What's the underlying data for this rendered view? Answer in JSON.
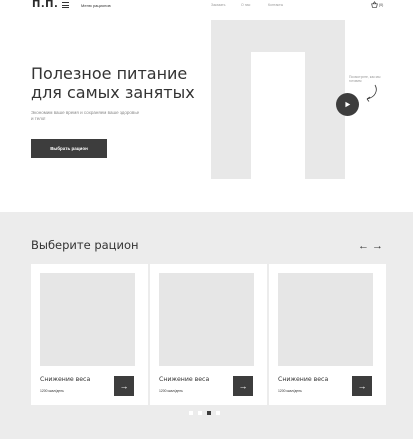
{
  "header": {
    "logo": "П.П.",
    "menu_label": "Меню рационов",
    "nav": [
      "Заказать",
      "О нас",
      "Контакты"
    ],
    "cart_count": "(0)"
  },
  "hero": {
    "title": "Полезное питание для самых занятых",
    "subtitle": "Экономим ваше время и сохраняем ваше здоровье и тело!",
    "button": "Выбрать рацион",
    "video_note": "Посмотрите, как мы готовим"
  },
  "section": {
    "title": "Выберите рацион",
    "prev_arrow": "←",
    "next_arrow": "→",
    "cards": [
      {
        "name": "Снижение веса",
        "kcal": "1200 ккал/день",
        "action": "→"
      },
      {
        "name": "Снижение веса",
        "kcal": "1200 ккал/день",
        "action": "→"
      },
      {
        "name": "Снижение веса",
        "kcal": "1200 ккал/день",
        "action": "→"
      }
    ],
    "pagination": {
      "pages": 4,
      "active": 3
    }
  },
  "colors": {
    "accent": "#3d3d3d",
    "placeholder": "#e6e6e6",
    "section_bg": "#ececec"
  }
}
